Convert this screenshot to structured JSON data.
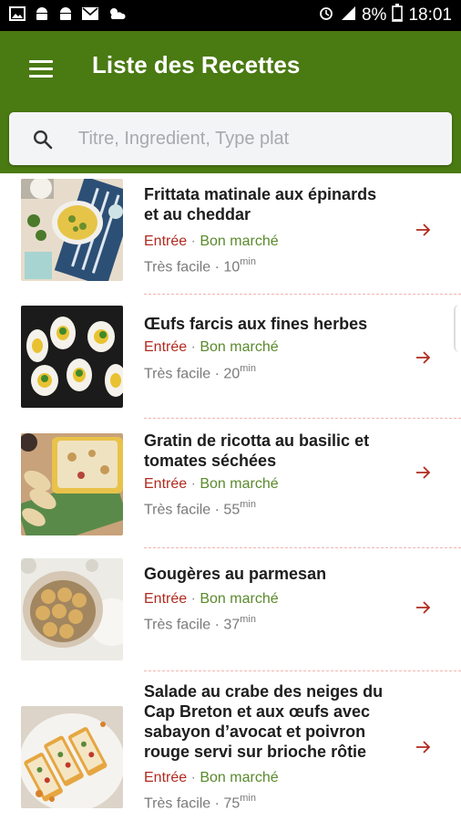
{
  "status_bar": {
    "battery": "8%",
    "time": "18:01",
    "icons": [
      "gallery-icon",
      "android-icon",
      "android-icon",
      "mail-icon",
      "weather-icon",
      "alarm-icon",
      "signal-icon",
      "battery-icon"
    ]
  },
  "app_bar": {
    "title": "Liste des Recettes",
    "color": "#4a7a12"
  },
  "search": {
    "placeholder": "Titre, Ingredient, Type plat",
    "value": ""
  },
  "recipes": [
    {
      "title_lines": [
        "Frittata matinale aux épinards",
        "et au cheddar"
      ],
      "course": "Entrée",
      "price": "Bon marché",
      "difficulty": "Très facile",
      "time": "10",
      "unit": "min"
    },
    {
      "title_lines": [
        "Œufs farcis aux fines herbes"
      ],
      "course": "Entrée",
      "price": "Bon marché",
      "difficulty": "Très facile",
      "time": "20",
      "unit": "min"
    },
    {
      "title_lines": [
        "Gratin de ricotta au basilic et",
        "tomates séchées"
      ],
      "course": "Entrée",
      "price": "Bon marché",
      "difficulty": "Très facile",
      "time": "55",
      "unit": "min"
    },
    {
      "title_lines": [
        "Gougères au parmesan"
      ],
      "course": "Entrée",
      "price": "Bon marché",
      "difficulty": "Très facile",
      "time": "37",
      "unit": "min"
    },
    {
      "title_lines": [
        "Salade au crabe des neiges du",
        "Cap Breton et aux œufs avec",
        "sabayon d’avocat et poivron",
        "rouge servi sur brioche rôtie"
      ],
      "course": "Entrée",
      "price": "Bon marché",
      "difficulty": "Très facile",
      "time": "75",
      "unit": "min"
    }
  ],
  "separator": " · ",
  "colors": {
    "course": "#b02a1f",
    "price": "#5a8a2c",
    "arrow": "#b02a1f"
  }
}
